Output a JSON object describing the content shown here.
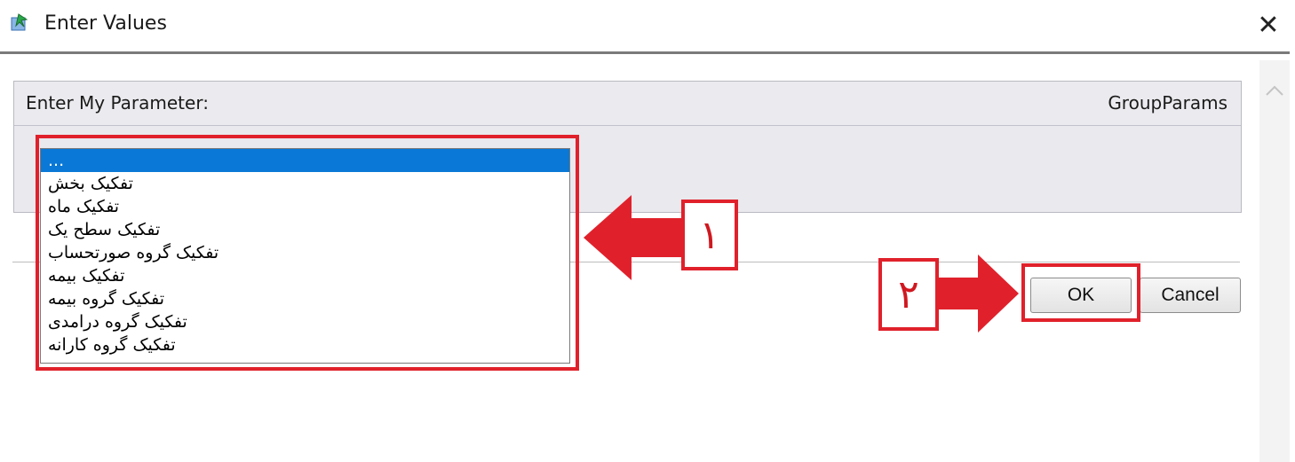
{
  "window": {
    "title": "Enter Values",
    "close_glyph": "✕",
    "icon": "install-arrow-icon"
  },
  "parameter": {
    "label": "Enter My Parameter:",
    "group": "GroupParams"
  },
  "listbox": {
    "items": [
      "...",
      "تفکیک بخش",
      "تفکیک ماه",
      "تفکیک سطح یک",
      "تفکیک گروه صورتحساب",
      "تفکیک بیمه",
      "تفکیک گروه بیمه",
      "تفکیک گروه درامدی",
      "تفکیک گروه کارانه"
    ],
    "selected_index": 0
  },
  "buttons": {
    "ok": "OK",
    "cancel": "Cancel"
  },
  "annotations": {
    "step1": "۱",
    "step2": "۲",
    "color": "#e0212b"
  },
  "colors": {
    "selection": "#0a78d6",
    "panel": "#e9e9ee"
  }
}
